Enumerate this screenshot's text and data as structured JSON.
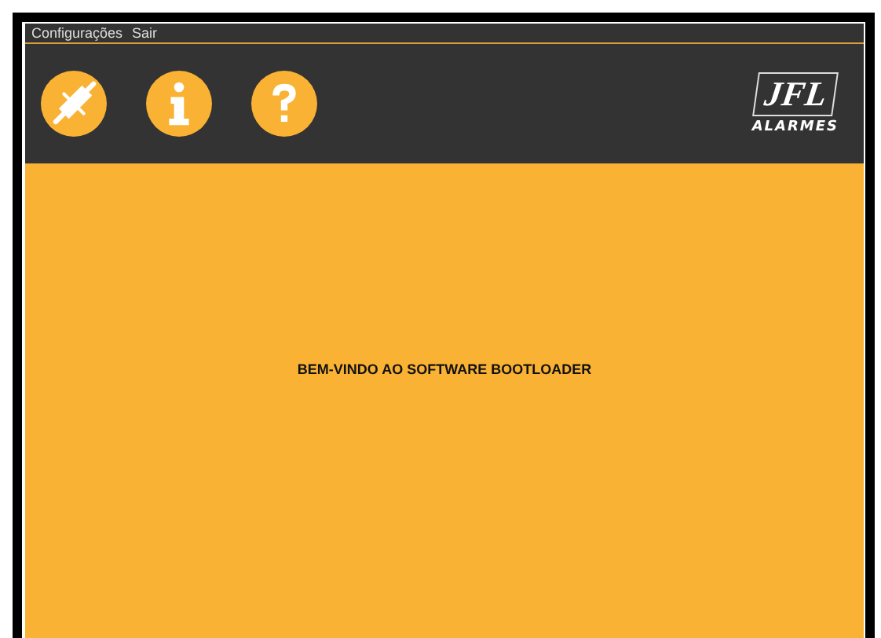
{
  "menu": [
    "Configurações",
    "Sair"
  ],
  "toolbar": [
    {
      "kind": "plug"
    },
    {
      "kind": "info"
    },
    {
      "kind": "help"
    }
  ],
  "logo": {
    "mark": "JFL",
    "caption": "ALARMES"
  },
  "welcome": "BEM-VINDO AO SOFTWARE BOOTLOADER"
}
